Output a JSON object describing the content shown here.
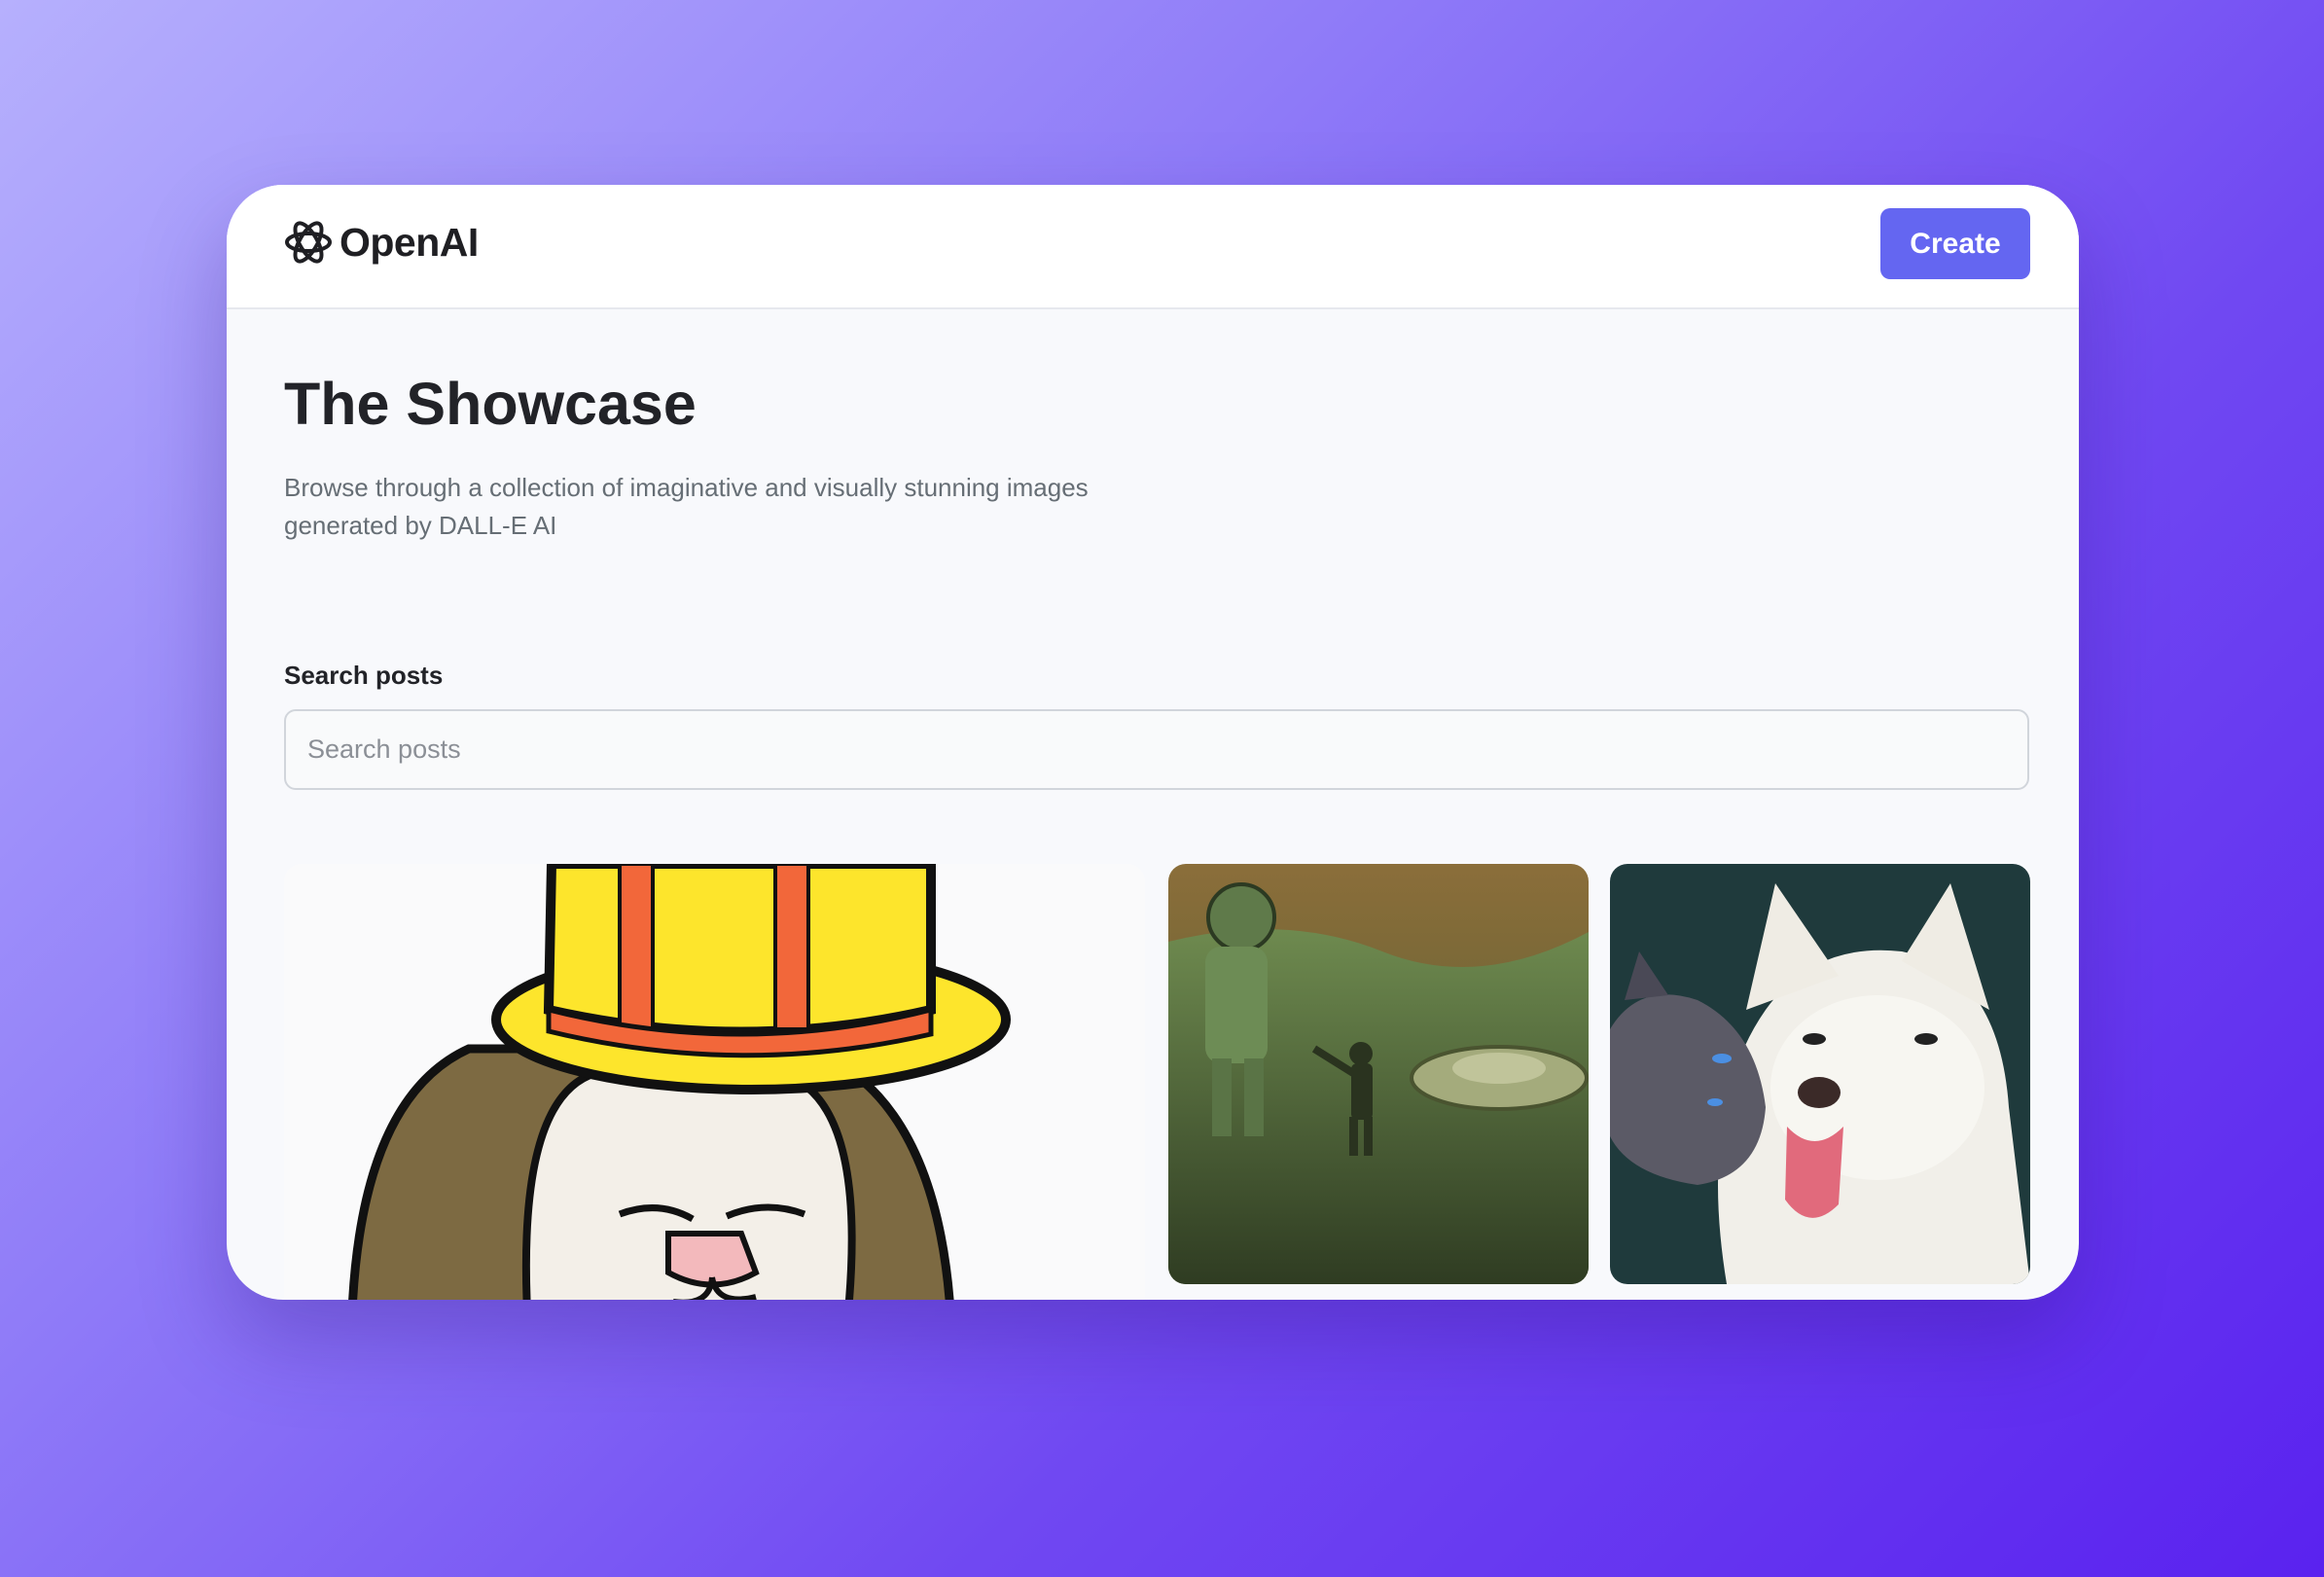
{
  "header": {
    "brand": "OpenAI",
    "create_label": "Create"
  },
  "hero": {
    "title": "The Showcase",
    "subtitle": "Browse through a collection of imaginative and visually stunning images generated by DALL-E AI"
  },
  "search": {
    "label": "Search posts",
    "placeholder": "Search posts",
    "value": ""
  },
  "gallery": {
    "items": [
      {
        "icon": "cartoon-dog-in-top-hat-image"
      },
      {
        "icon": "astronauts-on-alien-planet-image"
      },
      {
        "icon": "cat-and-dog-image"
      }
    ]
  },
  "colors": {
    "accent": "#6466f1",
    "title_text": "#222328",
    "body_text": "#666e75",
    "page_background": "#f8f9fc"
  }
}
